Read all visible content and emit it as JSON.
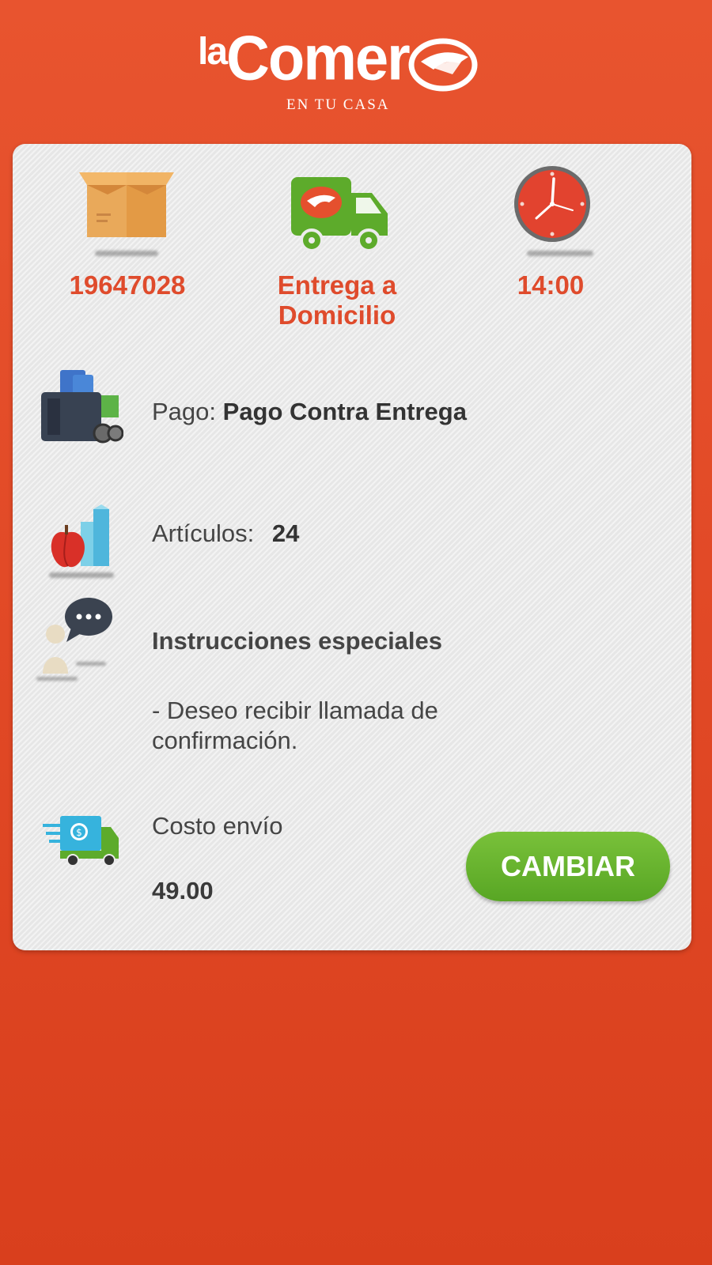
{
  "brand": {
    "name_prefix": "la",
    "name_main": "Comer",
    "tagline": "EN TU CASA"
  },
  "order": {
    "number": "19647028",
    "delivery_type_line1": "Entrega a",
    "delivery_type_line2": "Domicilio",
    "time": "14:00"
  },
  "payment": {
    "label": "Pago:",
    "value": "Pago Contra Entrega"
  },
  "items": {
    "label": "Artículos:",
    "count": "24"
  },
  "instructions": {
    "title": "Instrucciones especiales",
    "line1": "- Deseo recibir llamada de",
    "line2": "confirmación."
  },
  "shipping": {
    "label": "Costo envío",
    "cost": "49.00",
    "change_button": "CAMBIAR"
  },
  "icons": {
    "order": "box-icon",
    "delivery": "delivery-truck-icon",
    "time": "clock-icon",
    "payment": "wallet-icon",
    "items": "groceries-icon",
    "instructions": "chat-bubble-icon",
    "shipping": "shipping-cost-truck-icon"
  },
  "colors": {
    "background": "#e24a27",
    "accent_text": "#df4b2c",
    "button": "#66b22c",
    "card": "#ececec"
  }
}
